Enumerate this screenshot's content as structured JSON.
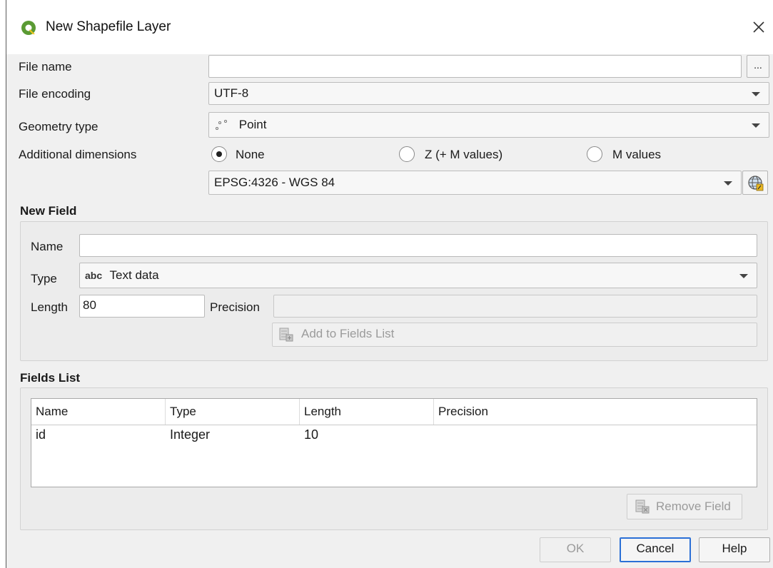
{
  "window": {
    "title": "New Shapefile Layer"
  },
  "labels": {
    "file_name": "File name",
    "file_encoding": "File encoding",
    "geometry_type": "Geometry type",
    "additional_dimensions": "Additional dimensions"
  },
  "file_name": {
    "value": "",
    "browse_label": "..."
  },
  "file_encoding": {
    "value": "UTF-8"
  },
  "geometry_type": {
    "value": "Point",
    "icon": "point-layer-icon"
  },
  "dimensions": {
    "options": [
      {
        "label": "None",
        "checked": true
      },
      {
        "label": "Z (+ M values)",
        "checked": false
      },
      {
        "label": "M values",
        "checked": false
      }
    ]
  },
  "crs": {
    "value": "EPSG:4326 - WGS 84",
    "button_icon": "projection-select-icon"
  },
  "new_field": {
    "heading": "New Field",
    "name_label": "Name",
    "name_value": "",
    "type_label": "Type",
    "type_icon_text": "abc",
    "type_value": "Text data",
    "length_label": "Length",
    "length_value": "80",
    "precision_label": "Precision",
    "precision_value": "",
    "add_button": "Add to Fields List"
  },
  "fields_list": {
    "heading": "Fields List",
    "columns": [
      "Name",
      "Type",
      "Length",
      "Precision"
    ],
    "rows": [
      {
        "name": "id",
        "type": "Integer",
        "length": "10",
        "precision": ""
      }
    ],
    "remove_button": "Remove Field"
  },
  "footer": {
    "ok": "OK",
    "cancel": "Cancel",
    "help": "Help"
  },
  "colors": {
    "qgis_green": "#5a9a33",
    "accent_blue": "#2a6fd6"
  }
}
